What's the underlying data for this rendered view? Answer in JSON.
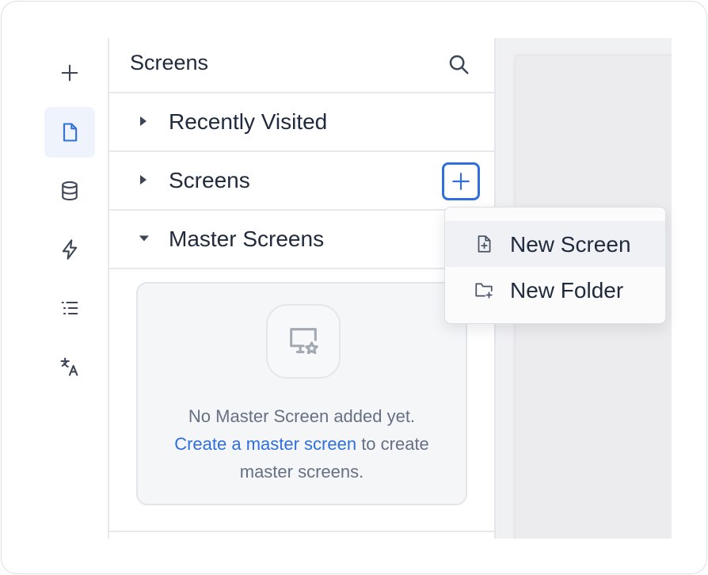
{
  "rail": {
    "items": [
      {
        "name": "add",
        "icon": "plus-icon",
        "active": false
      },
      {
        "name": "screens",
        "icon": "file-icon",
        "active": true
      },
      {
        "name": "data",
        "icon": "database-icon",
        "active": false
      },
      {
        "name": "actions",
        "icon": "lightning-icon",
        "active": false
      },
      {
        "name": "outline",
        "icon": "list-icon",
        "active": false
      },
      {
        "name": "translations",
        "icon": "translate-icon",
        "active": false
      }
    ]
  },
  "panel": {
    "title": "Screens",
    "sections": {
      "recent": {
        "label": "Recently Visited",
        "expanded": false
      },
      "screens": {
        "label": "Screens",
        "expanded": false
      },
      "master": {
        "label": "Master Screens",
        "expanded": true
      }
    },
    "empty_state": {
      "icon": "monitor-star-icon",
      "line1": "No Master Screen added yet.",
      "link": "Create a master screen",
      "line2_rest": " to create",
      "line3": "master screens."
    }
  },
  "add_menu": {
    "items": [
      {
        "label": "New Screen",
        "icon": "file-plus-icon"
      },
      {
        "label": "New Folder",
        "icon": "folder-plus-icon"
      }
    ]
  },
  "colors": {
    "accent": "#2f6fde",
    "active_bg": "#eef3fc",
    "text": "#1f2a3d",
    "muted": "#667085"
  }
}
